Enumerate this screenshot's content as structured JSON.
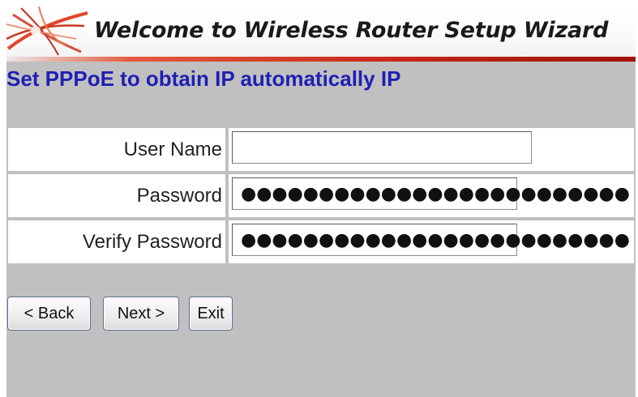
{
  "header": {
    "title": "Welcome to Wireless Router Setup Wizard",
    "logo_icon": "router-swoosh-logo",
    "accent_color": "#c8281a"
  },
  "subtitle": "Set PPPoE to obtain IP automatically IP",
  "form": {
    "user_name": {
      "label": "User Name",
      "value": ""
    },
    "password": {
      "label": "Password",
      "masked_value": "●●●●●●●●●●●●●●●●●●●●●●●●●"
    },
    "verify_password": {
      "label": "Verify Password",
      "masked_value": "●●●●●●●●●●●●●●●●●●●●●●●●●"
    }
  },
  "buttons": {
    "back": "< Back",
    "next": "Next >",
    "exit": "Exit"
  }
}
